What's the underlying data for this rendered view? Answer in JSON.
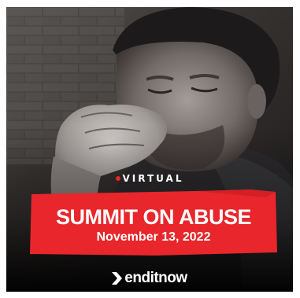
{
  "ad": {
    "badge": "VIRTUAL",
    "title": "SUMMIT ON ABUSE",
    "date": "November 13, 2022",
    "brand": "enditnow"
  },
  "colors": {
    "accent_red": "#e8262b",
    "background": "#111111",
    "text": "#ffffff"
  },
  "icons": {
    "badge_dot": "red-dot-icon",
    "logo_mark": "chevron-right-icon"
  }
}
